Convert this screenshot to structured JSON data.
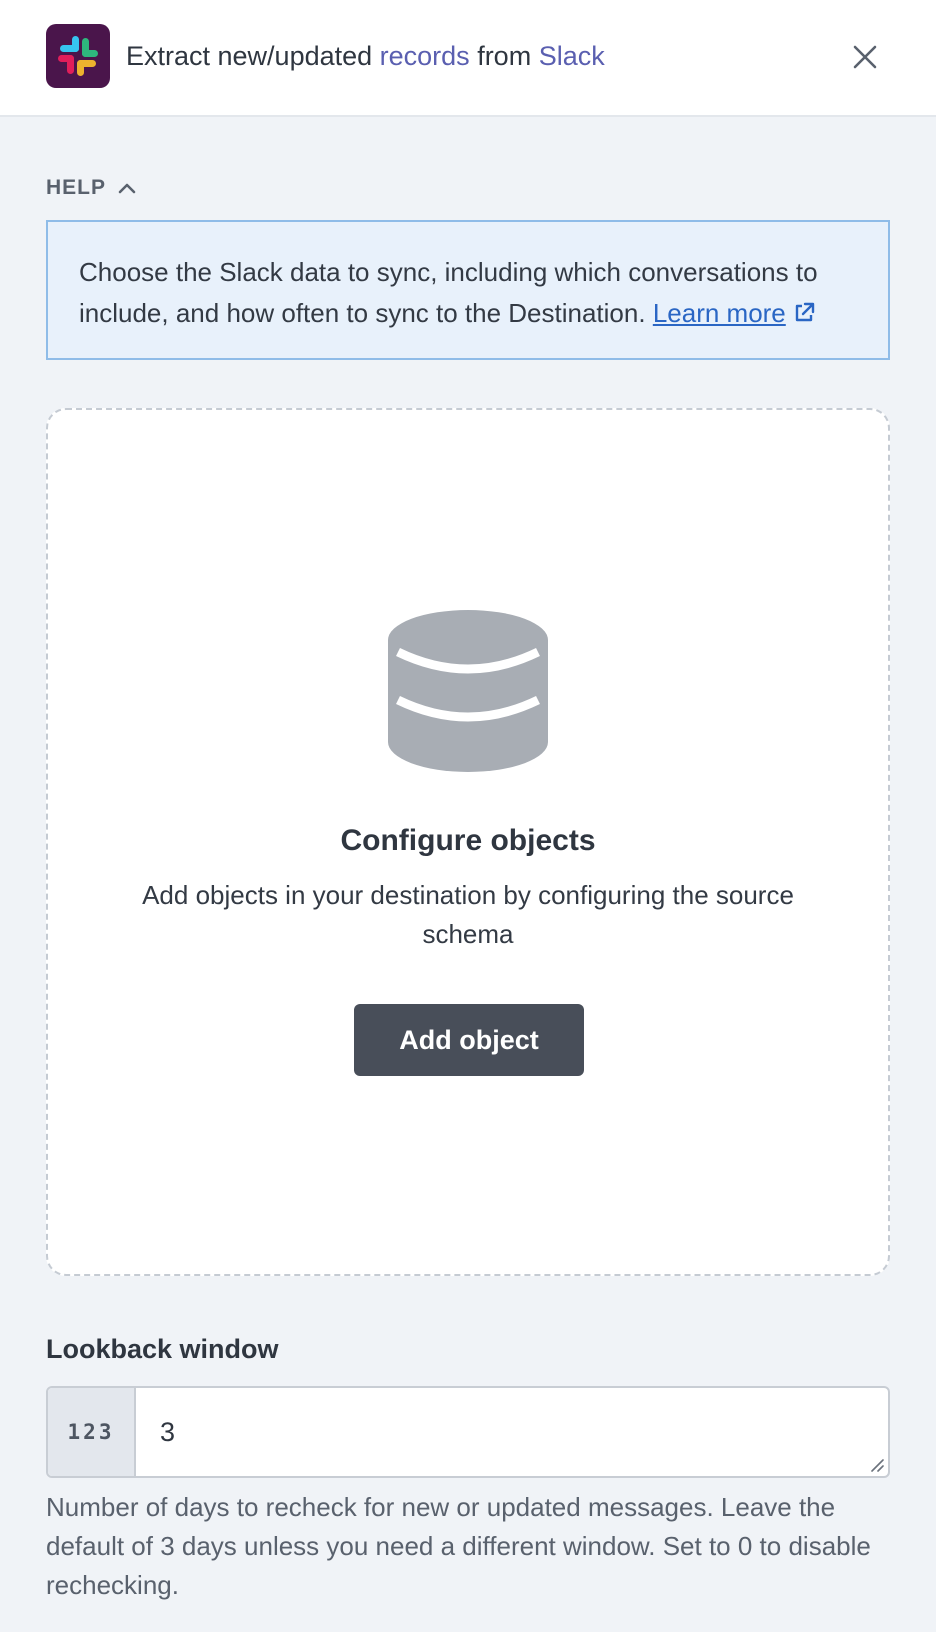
{
  "header": {
    "title_prefix": "Extract new/updated ",
    "title_records": "records",
    "title_middle": " from ",
    "title_source": "Slack",
    "logo_icon": "slack-logo-icon",
    "close_icon": "close-icon"
  },
  "help": {
    "toggle_label": "HELP",
    "toggle_icon": "chevron-up-icon",
    "text": "Choose the Slack data to sync, including which conversations to include, and how often to sync to the Destination. ",
    "link_label": "Learn more",
    "link_icon": "external-link-icon"
  },
  "objects": {
    "icon": "database-icon",
    "title": "Configure objects",
    "description": "Add objects in your destination by configuring the source schema",
    "button_label": "Add object"
  },
  "lookback": {
    "label": "Lookback window",
    "prefix": "123",
    "value": "3",
    "help_text": "Number of days to recheck for new or updated messages. Leave the default of 3 days unless you need a different window. Set to 0 to disable rechecking."
  },
  "colors": {
    "accent": "#5a5fb0",
    "link": "#2a66c4",
    "slack_bg": "#4a154b",
    "button_bg": "#484e59",
    "help_bg": "#e8f1fb",
    "help_border": "#8fbce8"
  }
}
